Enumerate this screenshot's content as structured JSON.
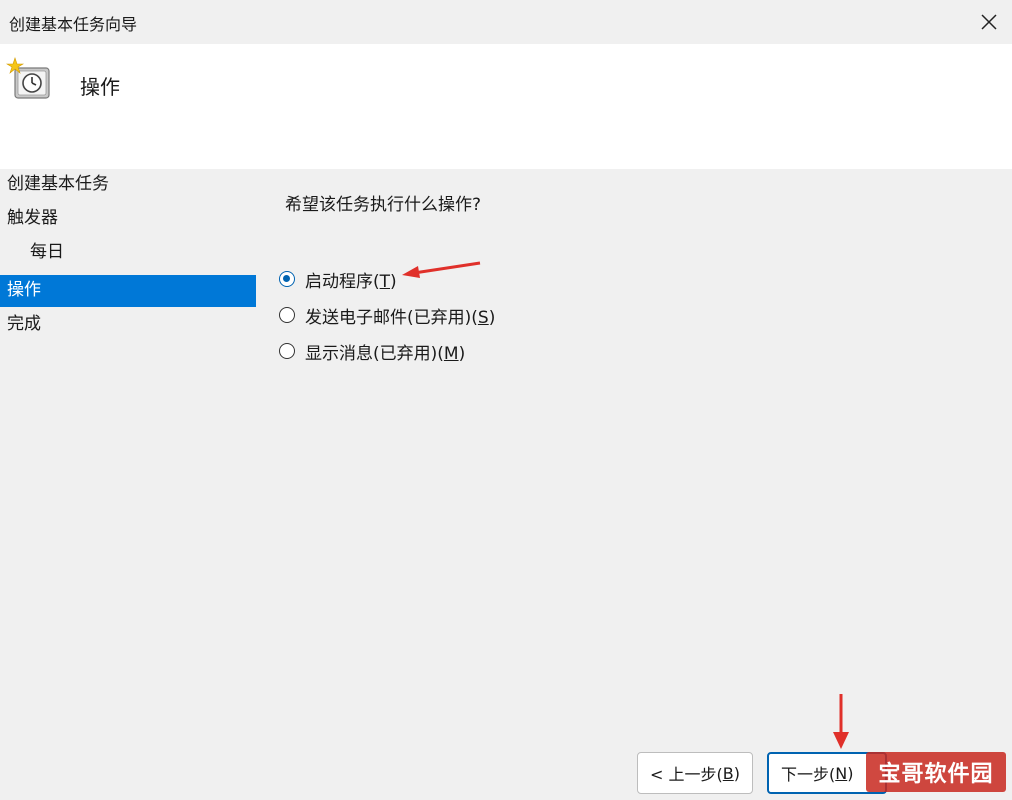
{
  "window": {
    "title": "创建基本任务向导"
  },
  "header": {
    "heading": "操作"
  },
  "sidebar": {
    "items": [
      {
        "label": "创建基本任务"
      },
      {
        "label": "触发器"
      },
      {
        "label": "每日"
      },
      {
        "label": "操作"
      },
      {
        "label": "完成"
      }
    ],
    "active_index": 3
  },
  "main": {
    "question": "希望该任务执行什么操作?",
    "options": [
      {
        "label": "启动程序(",
        "key": "T",
        "suffix": ")",
        "checked": true
      },
      {
        "label": "发送电子邮件(已弃用)(",
        "key": "S",
        "suffix": ")",
        "checked": false
      },
      {
        "label": "显示消息(已弃用)(",
        "key": "M",
        "suffix": ")",
        "checked": false
      }
    ]
  },
  "footer": {
    "back_label": "< 上一步(",
    "back_key": "B",
    "back_suffix": ")",
    "next_label": "下一步(",
    "next_key": "N",
    "next_suffix": ")"
  },
  "watermark": {
    "text": "宝哥软件园"
  },
  "colors": {
    "accent": "#0078d7",
    "annotation_arrow": "#e0302a",
    "watermark_bg": "#c8281e"
  },
  "icons": {
    "app": "task-scheduler-clock-icon",
    "close": "close-icon"
  }
}
